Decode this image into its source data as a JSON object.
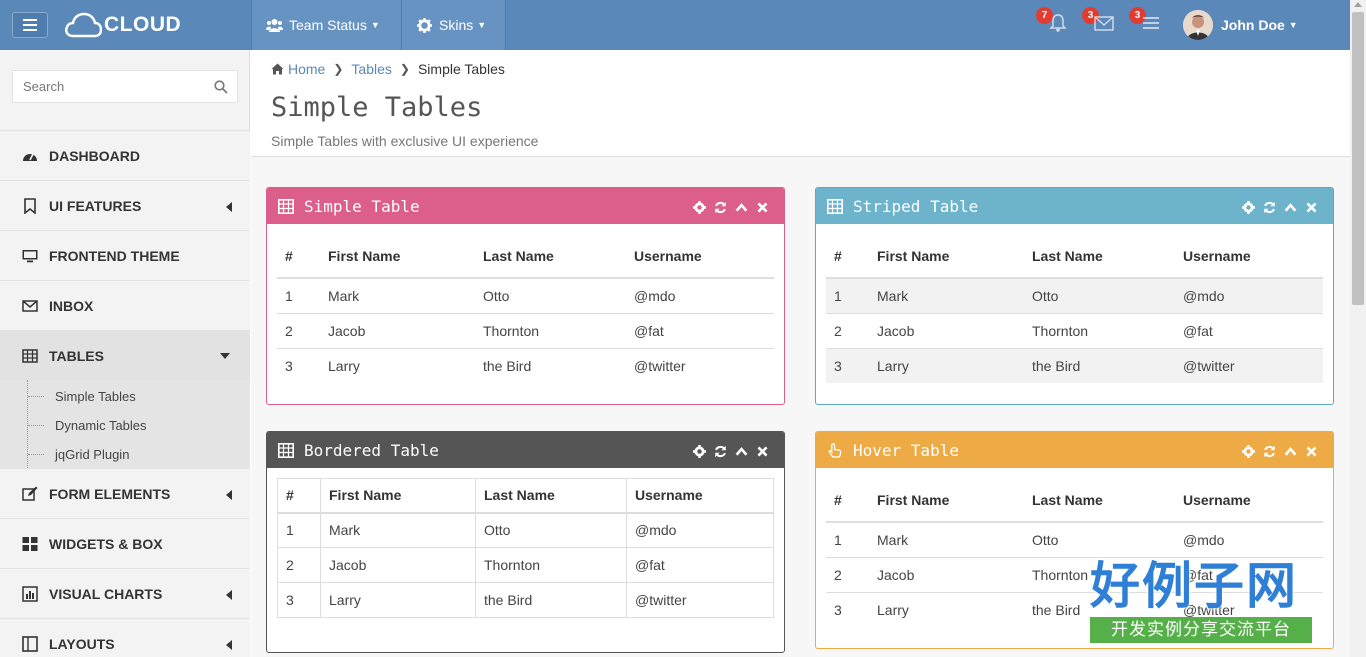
{
  "topbar": {
    "logo_text": "CLOUD",
    "nav": [
      {
        "label": "Team Status"
      },
      {
        "label": "Skins"
      }
    ],
    "notifications": {
      "bell_count": "7",
      "mail_count": "3",
      "tasks_count": "3"
    },
    "user_name": "John Doe"
  },
  "sidebar": {
    "search_placeholder": "Search",
    "items": [
      {
        "label": "DASHBOARD",
        "icon": "dashboard-icon"
      },
      {
        "label": "UI FEATURES",
        "icon": "bookmark-icon"
      },
      {
        "label": "FRONTEND THEME",
        "icon": "monitor-icon"
      },
      {
        "label": "INBOX",
        "icon": "envelope-icon"
      },
      {
        "label": "TABLES",
        "icon": "table-icon"
      },
      {
        "label": "FORM ELEMENTS",
        "icon": "edit-icon"
      },
      {
        "label": "WIDGETS & BOX",
        "icon": "grid-icon"
      },
      {
        "label": "VISUAL CHARTS",
        "icon": "bar-chart-icon"
      },
      {
        "label": "LAYOUTS",
        "icon": "layout-icon"
      }
    ],
    "tables_submenu": [
      {
        "label": "Simple Tables"
      },
      {
        "label": "Dynamic Tables"
      },
      {
        "label": "jqGrid Plugin"
      }
    ]
  },
  "breadcrumb": {
    "home": "Home",
    "tables": "Tables",
    "current": "Simple Tables"
  },
  "page": {
    "title": "Simple Tables",
    "subtitle": "Simple Tables with exclusive UI experience"
  },
  "panels": {
    "simple": {
      "title": "Simple Table",
      "color": "#dc5e8b"
    },
    "striped": {
      "title": "Striped Table",
      "color": "#6eb3cc"
    },
    "bordered": {
      "title": "Bordered Table",
      "color": "#555555"
    },
    "hover": {
      "title": "Hover Table",
      "color": "#eeaa45"
    }
  },
  "table": {
    "headers": [
      "#",
      "First Name",
      "Last Name",
      "Username"
    ],
    "rows": [
      [
        "1",
        "Mark",
        "Otto",
        "@mdo"
      ],
      [
        "2",
        "Jacob",
        "Thornton",
        "@fat"
      ],
      [
        "3",
        "Larry",
        "the Bird",
        "@twitter"
      ]
    ]
  },
  "watermark": {
    "big": "好例子网",
    "small": "开发实例分享交流平台"
  }
}
